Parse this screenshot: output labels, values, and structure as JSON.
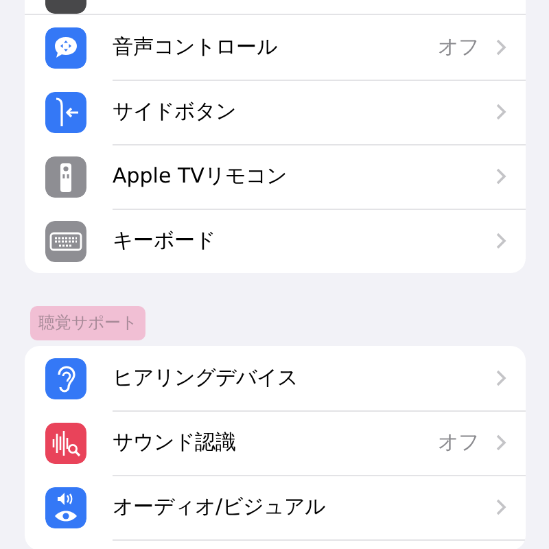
{
  "sections": [
    {
      "items": [
        {
          "kind": "cut"
        },
        {
          "kind": "row",
          "label": "音声コントロール",
          "value": "オフ"
        },
        {
          "kind": "row",
          "label": "サイドボタン"
        },
        {
          "kind": "row",
          "label": "Apple TVリモコン"
        },
        {
          "kind": "row",
          "label": "キーボード"
        }
      ]
    },
    {
      "header": "聴覚サポート",
      "highlighted": true,
      "items": [
        {
          "kind": "row",
          "label": "ヒアリングデバイス"
        },
        {
          "kind": "row",
          "label": "サウンド認識",
          "value": "オフ"
        },
        {
          "kind": "row",
          "label": "オーディオ/ビジュアル"
        },
        {
          "kind": "cut"
        }
      ]
    }
  ]
}
